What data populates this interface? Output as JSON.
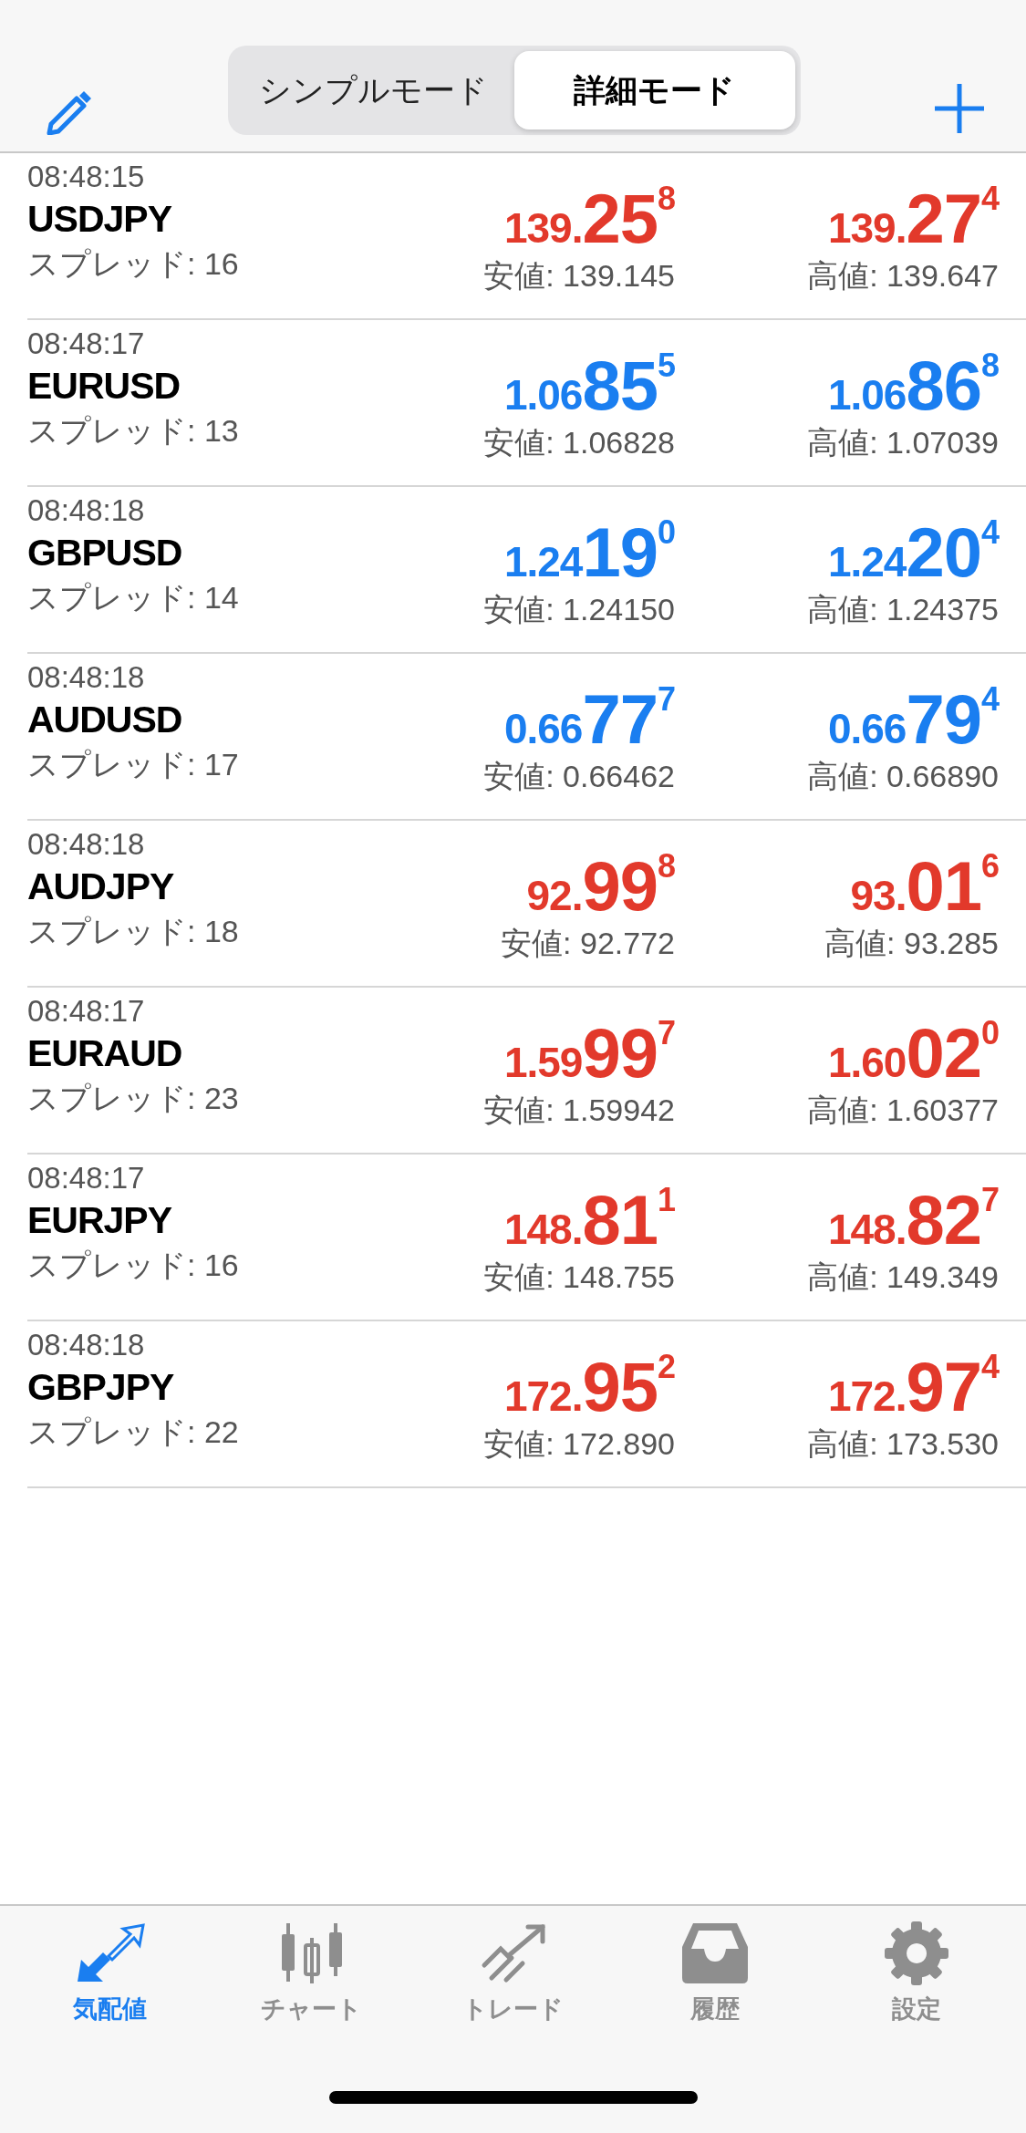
{
  "header": {
    "segments": [
      {
        "label": "シンプルモード",
        "selected": false
      },
      {
        "label": "詳細モード",
        "selected": true
      }
    ]
  },
  "quotes": [
    {
      "time": "08:48:15",
      "symbol": "USDJPY",
      "spread": "スプレッド: 16",
      "bid": {
        "prefix": "139.",
        "big": "25",
        "sup": "8",
        "color": "#e2392b"
      },
      "ask": {
        "prefix": "139.",
        "big": "27",
        "sup": "4",
        "color": "#e2392b"
      },
      "low": "安値: 139.145",
      "high": "高値: 139.647"
    },
    {
      "time": "08:48:17",
      "symbol": "EURUSD",
      "spread": "スプレッド: 13",
      "bid": {
        "prefix": "1.06",
        "big": "85",
        "sup": "5",
        "color": "#1a7ef0"
      },
      "ask": {
        "prefix": "1.06",
        "big": "86",
        "sup": "8",
        "color": "#1a7ef0"
      },
      "low": "安値: 1.06828",
      "high": "高値: 1.07039"
    },
    {
      "time": "08:48:18",
      "symbol": "GBPUSD",
      "spread": "スプレッド: 14",
      "bid": {
        "prefix": "1.24",
        "big": "19",
        "sup": "0",
        "color": "#1a7ef0"
      },
      "ask": {
        "prefix": "1.24",
        "big": "20",
        "sup": "4",
        "color": "#1a7ef0"
      },
      "low": "安値: 1.24150",
      "high": "高値: 1.24375"
    },
    {
      "time": "08:48:18",
      "symbol": "AUDUSD",
      "spread": "スプレッド: 17",
      "bid": {
        "prefix": "0.66",
        "big": "77",
        "sup": "7",
        "color": "#1a7ef0"
      },
      "ask": {
        "prefix": "0.66",
        "big": "79",
        "sup": "4",
        "color": "#1a7ef0"
      },
      "low": "安値: 0.66462",
      "high": "高値: 0.66890"
    },
    {
      "time": "08:48:18",
      "symbol": "AUDJPY",
      "spread": "スプレッド: 18",
      "bid": {
        "prefix": "92.",
        "big": "99",
        "sup": "8",
        "color": "#e2392b"
      },
      "ask": {
        "prefix": "93.",
        "big": "01",
        "sup": "6",
        "color": "#e2392b"
      },
      "low": "安値: 92.772",
      "high": "高値: 93.285"
    },
    {
      "time": "08:48:17",
      "symbol": "EURAUD",
      "spread": "スプレッド: 23",
      "bid": {
        "prefix": "1.59",
        "big": "99",
        "sup": "7",
        "color": "#e2392b"
      },
      "ask": {
        "prefix": "1.60",
        "big": "02",
        "sup": "0",
        "color": "#e2392b"
      },
      "low": "安値: 1.59942",
      "high": "高値: 1.60377"
    },
    {
      "time": "08:48:17",
      "symbol": "EURJPY",
      "spread": "スプレッド: 16",
      "bid": {
        "prefix": "148.",
        "big": "81",
        "sup": "1",
        "color": "#e2392b"
      },
      "ask": {
        "prefix": "148.",
        "big": "82",
        "sup": "7",
        "color": "#e2392b"
      },
      "low": "安値: 148.755",
      "high": "高値: 149.349"
    },
    {
      "time": "08:48:18",
      "symbol": "GBPJPY",
      "spread": "スプレッド: 22",
      "bid": {
        "prefix": "172.",
        "big": "95",
        "sup": "2",
        "color": "#e2392b"
      },
      "ask": {
        "prefix": "172.",
        "big": "97",
        "sup": "4",
        "color": "#e2392b"
      },
      "low": "安値: 172.890",
      "high": "高値: 173.530"
    }
  ],
  "tab_bar": [
    {
      "kind": "quotes",
      "label": "気配値",
      "selected": true
    },
    {
      "kind": "chart",
      "label": "チャート",
      "selected": false
    },
    {
      "kind": "trade",
      "label": "トレード",
      "selected": false
    },
    {
      "kind": "history",
      "label": "履歴",
      "selected": false
    },
    {
      "kind": "settings",
      "label": "設定",
      "selected": false
    }
  ]
}
